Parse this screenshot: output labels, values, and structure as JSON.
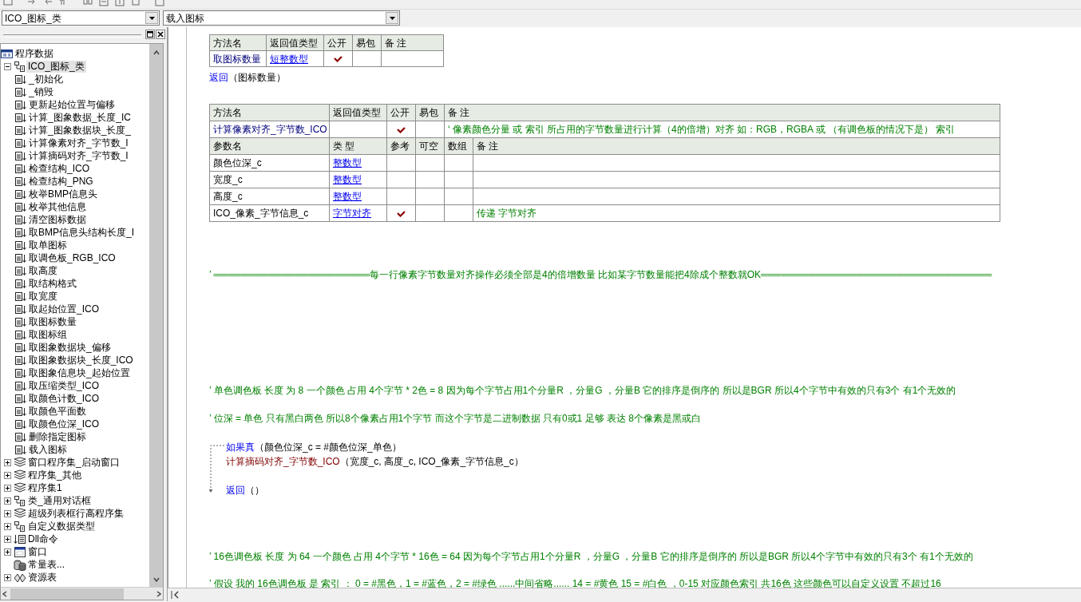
{
  "toolbar": {
    "combos": [
      {
        "value": "ICO_图标_类"
      },
      {
        "value": "载入图标"
      }
    ]
  },
  "tree": [
    {
      "label": "程序数据",
      "kind": "data",
      "selected": false,
      "children": [
        {
          "label": "ICO_图标_类",
          "kind": "class",
          "expanded": true,
          "selected": true,
          "children": [
            {
              "label": "_初始化",
              "kind": "method",
              "selected": false
            },
            {
              "label": "_销毁",
              "kind": "method",
              "selected": false
            },
            {
              "label": "更新起始位置与偏移",
              "kind": "method",
              "selected": false
            },
            {
              "label": "计算_图象数据_长度_IC",
              "kind": "method",
              "selected": false
            },
            {
              "label": "计算_图象数据块_长度_",
              "kind": "method",
              "selected": false
            },
            {
              "label": "计算像素对齐_字节数_I",
              "kind": "method",
              "selected": false
            },
            {
              "label": "计算摘码对齐_字节数_I",
              "kind": "method",
              "selected": false
            },
            {
              "label": "检查结构_ICO",
              "kind": "method",
              "selected": false
            },
            {
              "label": "检查结构_PNG",
              "kind": "method",
              "selected": false
            },
            {
              "label": "枚举BMP信息头",
              "kind": "method",
              "selected": false
            },
            {
              "label": "枚举其他信息",
              "kind": "method",
              "selected": false
            },
            {
              "label": "清空图标数据",
              "kind": "method",
              "selected": false
            },
            {
              "label": "取BMP信息头结构长度_I",
              "kind": "method",
              "selected": false
            },
            {
              "label": "取单图标",
              "kind": "method",
              "selected": false
            },
            {
              "label": "取调色板_RGB_ICO",
              "kind": "method",
              "selected": false
            },
            {
              "label": "取高度",
              "kind": "method",
              "selected": false
            },
            {
              "label": "取结构格式",
              "kind": "method",
              "selected": false
            },
            {
              "label": "取宽度",
              "kind": "method",
              "selected": false
            },
            {
              "label": "取起始位置_ICO",
              "kind": "method",
              "selected": false
            },
            {
              "label": "取图标数量",
              "kind": "method",
              "selected": false
            },
            {
              "label": "取图标组",
              "kind": "method",
              "selected": false
            },
            {
              "label": "取图象数据块_偏移",
              "kind": "method",
              "selected": false
            },
            {
              "label": "取图象数据块_长度_ICO",
              "kind": "method",
              "selected": false
            },
            {
              "label": "取图象信息块_起始位置",
              "kind": "method",
              "selected": false
            },
            {
              "label": "取压缩类型_ICO",
              "kind": "method",
              "selected": false
            },
            {
              "label": "取颜色计数_ICO",
              "kind": "method",
              "selected": false
            },
            {
              "label": "取颜色平面数",
              "kind": "method",
              "selected": false
            },
            {
              "label": "取颜色位深_ICO",
              "kind": "method",
              "selected": false
            },
            {
              "label": "删除指定图标",
              "kind": "method",
              "selected": false
            },
            {
              "label": "载入图标",
              "kind": "method",
              "selected": false
            }
          ]
        },
        {
          "label": "窗口程序集_启动窗口",
          "kind": "module",
          "expanded": false,
          "selected": false
        },
        {
          "label": "程序集_其他",
          "kind": "module",
          "expanded": false,
          "selected": false
        },
        {
          "label": "程序集1",
          "kind": "module",
          "expanded": false,
          "selected": false
        },
        {
          "label": "类_通用对话框",
          "kind": "class",
          "expanded": false,
          "selected": false
        },
        {
          "label": "超级列表框行高程序集",
          "kind": "module",
          "expanded": false,
          "selected": false
        },
        {
          "label": "自定义数据类型",
          "kind": "class",
          "expanded": false,
          "selected": false
        },
        {
          "label": "Dll命令",
          "kind": "dll",
          "expanded": false,
          "selected": false
        },
        {
          "label": "窗口",
          "kind": "window",
          "expanded": false,
          "selected": false
        },
        {
          "label": "常量表...",
          "kind": "constants",
          "selected": false
        },
        {
          "label": "资源表",
          "kind": "resources",
          "expanded": false,
          "selected": false
        }
      ]
    }
  ],
  "editor": {
    "blocks": [
      {
        "kind": "method_table",
        "columns": [
          "方法名",
          "返回值类型",
          "公开",
          "易包",
          "备 注"
        ],
        "method": {
          "name": "取图标数量",
          "return_type": "短整数型",
          "public": true,
          "easy_pack": false
        }
      },
      {
        "kind": "return",
        "keyword": "返回",
        "args": "（图标数量）"
      },
      {
        "kind": "method_table",
        "columns": [
          "方法名",
          "返回值类型",
          "公开",
          "易包",
          "备 注"
        ],
        "method": {
          "name": "计算像素对齐_字节数_ICO",
          "public": true,
          "easy_pack": false,
          "remark": "‘ 像素颜色分量 或 索引 所占用的字节数量进行计算（4的倍增）对齐  如：RGB，RGBA  或 （有调色板的情况下是） 索引"
        },
        "param_columns": [
          "参数名",
          "类 型",
          "参考",
          "可空",
          "数组",
          "备 注"
        ],
        "params": [
          {
            "name": "颜色位深_c",
            "type": "整数型",
            "reference": false,
            "nullable": false,
            "array": false
          },
          {
            "name": "宽度_c",
            "type": "整数型",
            "reference": false,
            "nullable": false,
            "array": false
          },
          {
            "name": "高度_c",
            "type": "整数型",
            "reference": false,
            "nullable": false,
            "array": false
          },
          {
            "name": "ICO_像素_字节信息_c",
            "type": "字节对齐",
            "reference": true,
            "nullable": false,
            "array": false,
            "remark": "传递 字节对齐"
          }
        ]
      },
      {
        "kind": "comment",
        "text": "’ ═══════════════════════每一行像素字节数量对齐操作必须全部是4的倍增数量  比如某字节数量能把4除成个整数就OK══════════════════════════════════"
      },
      {
        "kind": "comment",
        "text": "’ 单色调色板 长度 为 8 一个颜色 占用 4个字节 * 2色 = 8 因为每个字节占用1个分量R ，分量G ，分量B 它的排序是倒序的 所以是BGR  所以4个字节中有效的只有3个 有1个无效的"
      },
      {
        "kind": "comment",
        "text": "’ 位深 = 单色 只有黑白两色 所以8个像素占用1个字节 而这个字节是二进制数据 只有0或1 足够 表达 8个像素是黑或白"
      },
      {
        "kind": "if",
        "keyword": "如果真",
        "args": "（颜色位深_c = #颜色位深_单色）",
        "body": [
          {
            "kind": "call",
            "name": "计算摘码对齐_字节数_ICO",
            "args": "（宽度_c, 高度_c, ICO_像素_字节信息_c）"
          },
          {
            "kind": "return",
            "keyword": "返回",
            "args": "（）"
          }
        ]
      },
      {
        "kind": "comment",
        "text": "’ 16色调色板 长度 为 64 一个颜色 占用 4个字节 * 16色 = 64  因为每个字节占用1个分量R ，分量G ，分量B 它的排序是倒序的 所以是BGR  所以4个字节中有效的只有3个 有1个无效的"
      },
      {
        "kind": "comment",
        "text": "’ 假设 我的 16色调色板 是 索引 ： 0 = #黑色，1 = #蓝色，2 = #绿色 ......中间省略...... 14 = #黄色  15 = #白色  ，0-15 对应颜色索引 共16色 这些颜色可以自定义设置 不超过16"
      }
    ]
  }
}
